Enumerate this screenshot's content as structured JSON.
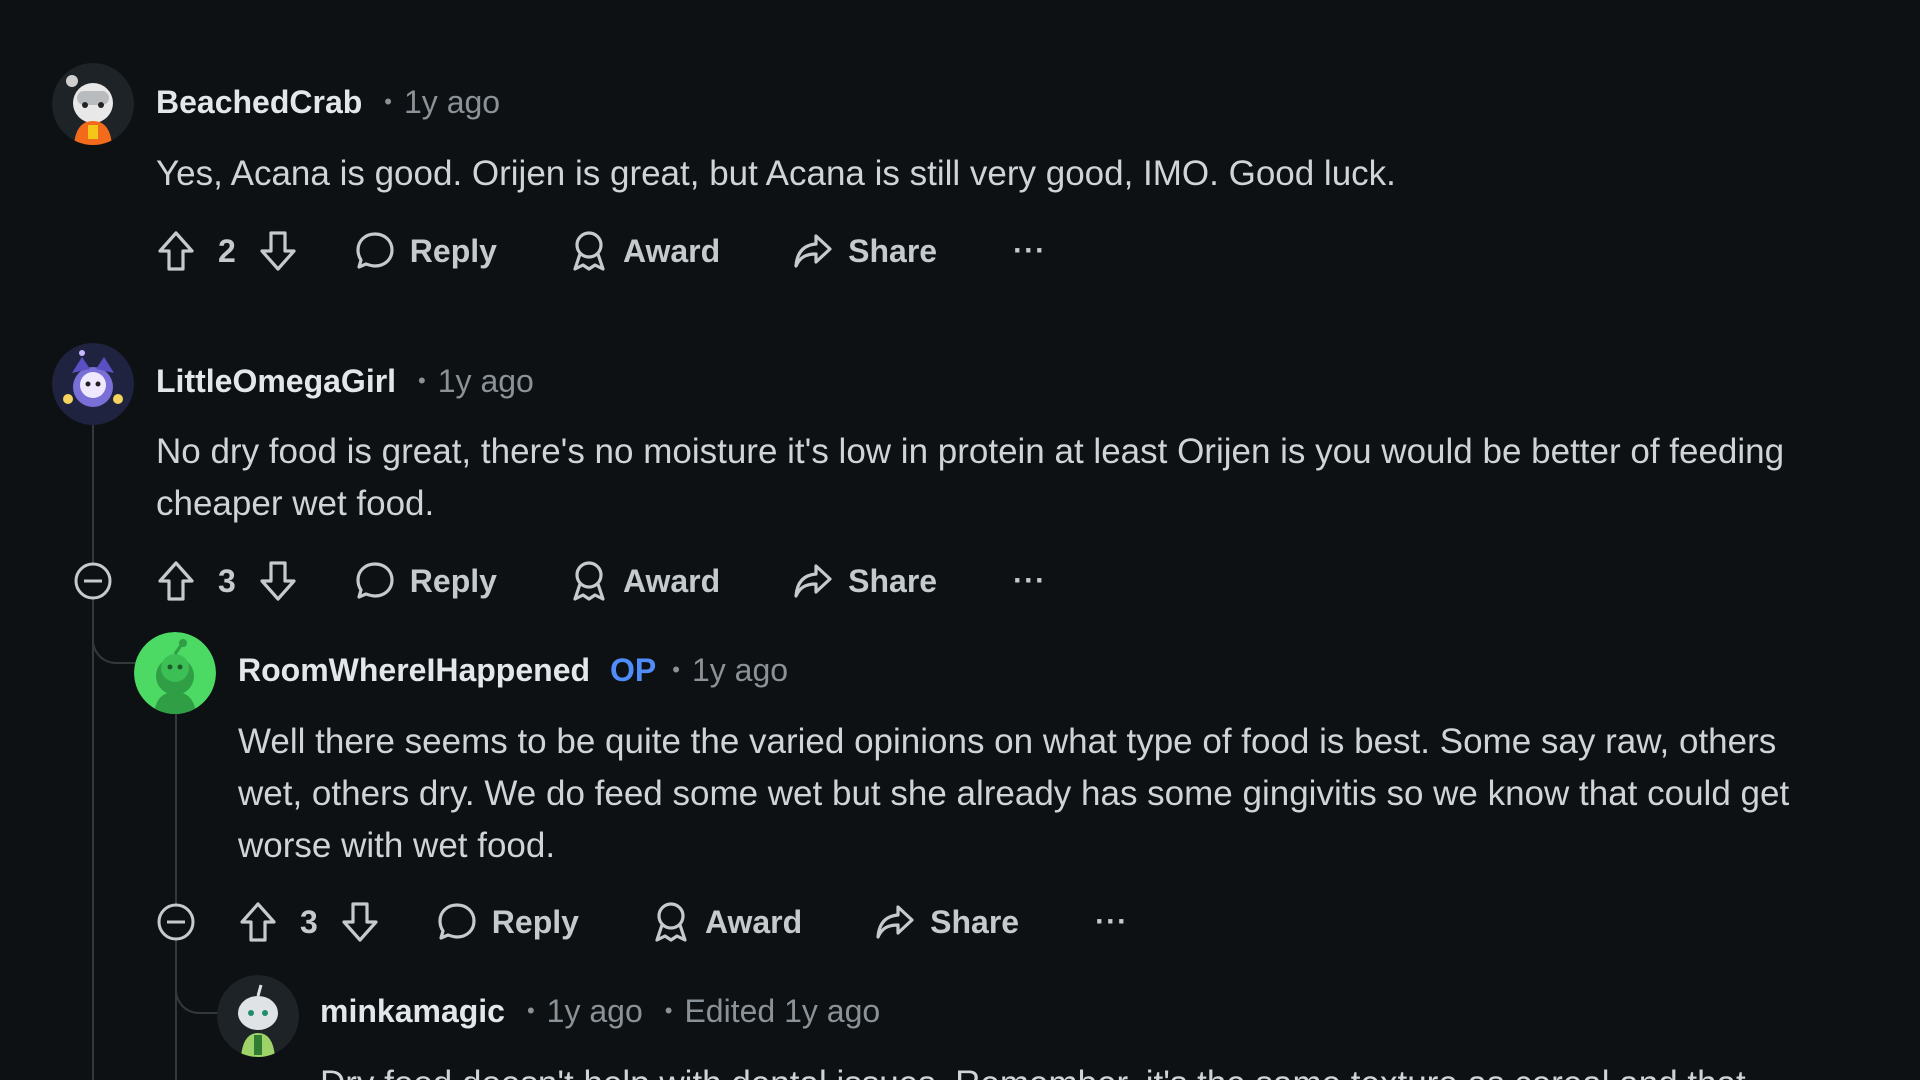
{
  "comments": [
    {
      "username": "BeachedCrab",
      "time": "1y ago",
      "body": [
        "Yes, Acana is good. Orijen is great, but Acana is still very good, IMO. Good luck."
      ],
      "votes": "2",
      "actions": {
        "reply": "Reply",
        "award": "Award",
        "share": "Share",
        "more": "···"
      }
    },
    {
      "username": "LittleOmegaGirl",
      "time": "1y ago",
      "body": [
        "No dry food is great, there's no moisture it's low in protein at least Orijen is you would be better of feeding",
        "cheaper wet food."
      ],
      "votes": "3",
      "actions": {
        "reply": "Reply",
        "award": "Award",
        "share": "Share",
        "more": "···"
      }
    },
    {
      "username": "RoomWhereIHappened",
      "op_badge": "OP",
      "time": "1y ago",
      "body": [
        "Well there seems to be quite the varied opinions on what type of food is best. Some say raw, others",
        "wet, others dry. We do feed some wet but she already has some gingivitis so we know that could get",
        "worse with wet food."
      ],
      "votes": "3",
      "actions": {
        "reply": "Reply",
        "award": "Award",
        "share": "Share",
        "more": "···"
      }
    },
    {
      "username": "minkamagic",
      "time": "1y ago",
      "edited": "Edited 1y ago",
      "body": [
        "Dry food doesn't help with dental issues. Remember, it's the same texture as cereal and that"
      ]
    }
  ],
  "colors": {
    "background": "#0e1113",
    "op_badge": "#4f8dfb",
    "thread_line": "#33383b"
  }
}
